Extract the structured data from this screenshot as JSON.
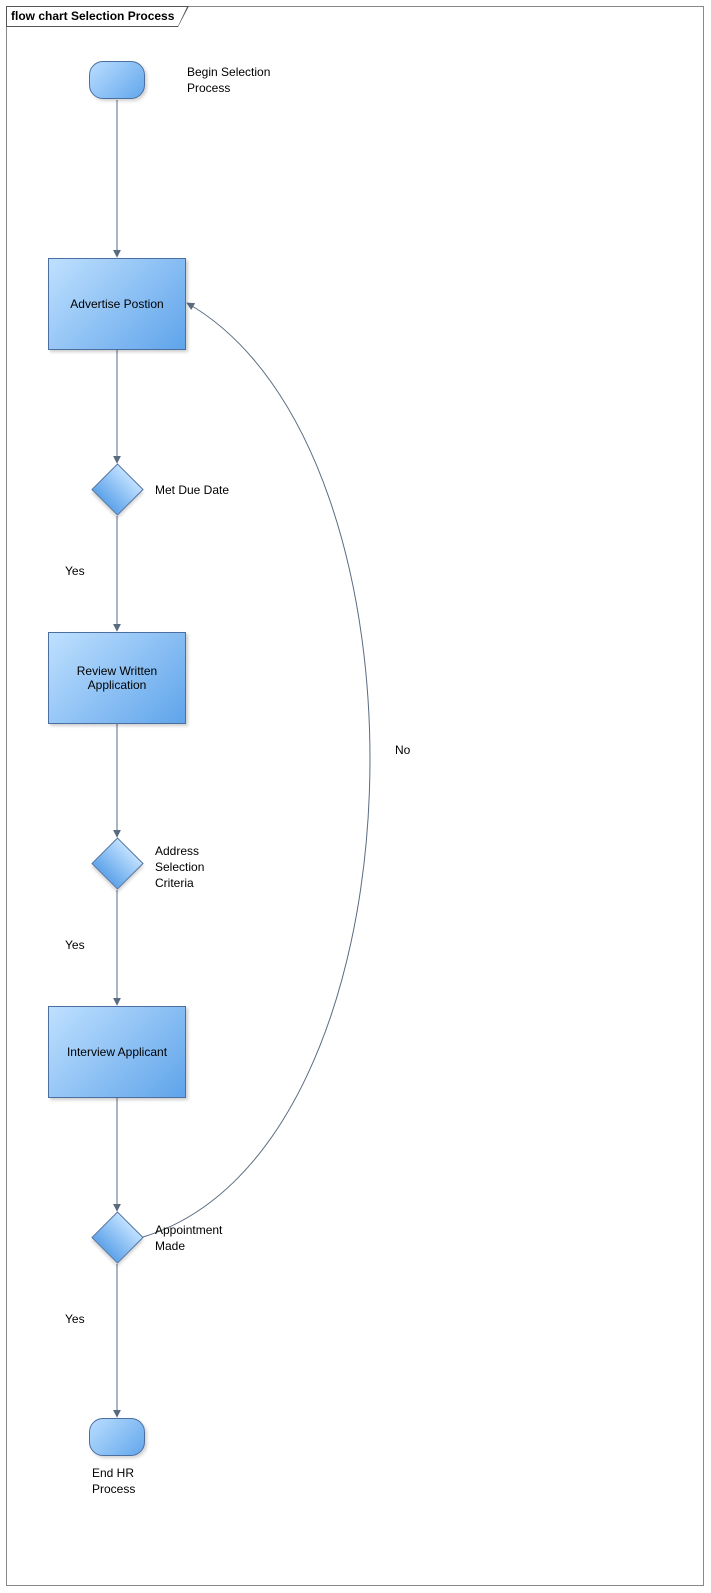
{
  "diagram": {
    "title": "flow chart Selection Process",
    "nodes": {
      "start_label": "Begin Selection Process",
      "advertise": "Advertise Postion",
      "decision_due": "Met Due Date",
      "review": "Review Written Application",
      "decision_criteria": "Address Selection Criteria",
      "interview": "Interview Applicant",
      "decision_appt": "Appointment Made",
      "end_label": "End HR Process"
    },
    "edges": {
      "yes1": "Yes",
      "yes2": "Yes",
      "yes3": "Yes",
      "no": "No"
    }
  }
}
